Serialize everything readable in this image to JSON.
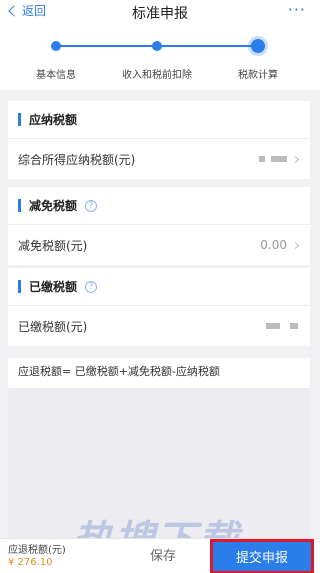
{
  "nav": {
    "back_label": "返回",
    "title": "标准申报",
    "more": "···"
  },
  "steps": [
    "基本信息",
    "收入和税前扣除",
    "税款计算"
  ],
  "sections": {
    "payable": {
      "title": "应纳税额",
      "row_label": "综合所得应纳税额(元)",
      "row_value": ""
    },
    "reduction": {
      "title": "减免税额",
      "row_label": "减免税额(元)",
      "row_value": "0.00"
    },
    "paid": {
      "title": "已缴税额",
      "row_label": "已缴税额(元)",
      "row_value": ""
    }
  },
  "formula": "应退税额= 已缴税额+减免税额-应纳税额",
  "footer": {
    "refund_label": "应退税额(元)",
    "refund_amount": "¥ 276.10",
    "save_label": "保存",
    "submit_label": "提交申报"
  },
  "watermark": "热搜下载",
  "colors": {
    "accent": "#2b7de9",
    "highlight_border": "#e0182b",
    "amount": "#e08a1a"
  },
  "icons": {
    "back": "chevron-left-icon",
    "more": "more-dots-icon",
    "help": "help-circle-icon",
    "arrow": "chevron-right-icon"
  }
}
